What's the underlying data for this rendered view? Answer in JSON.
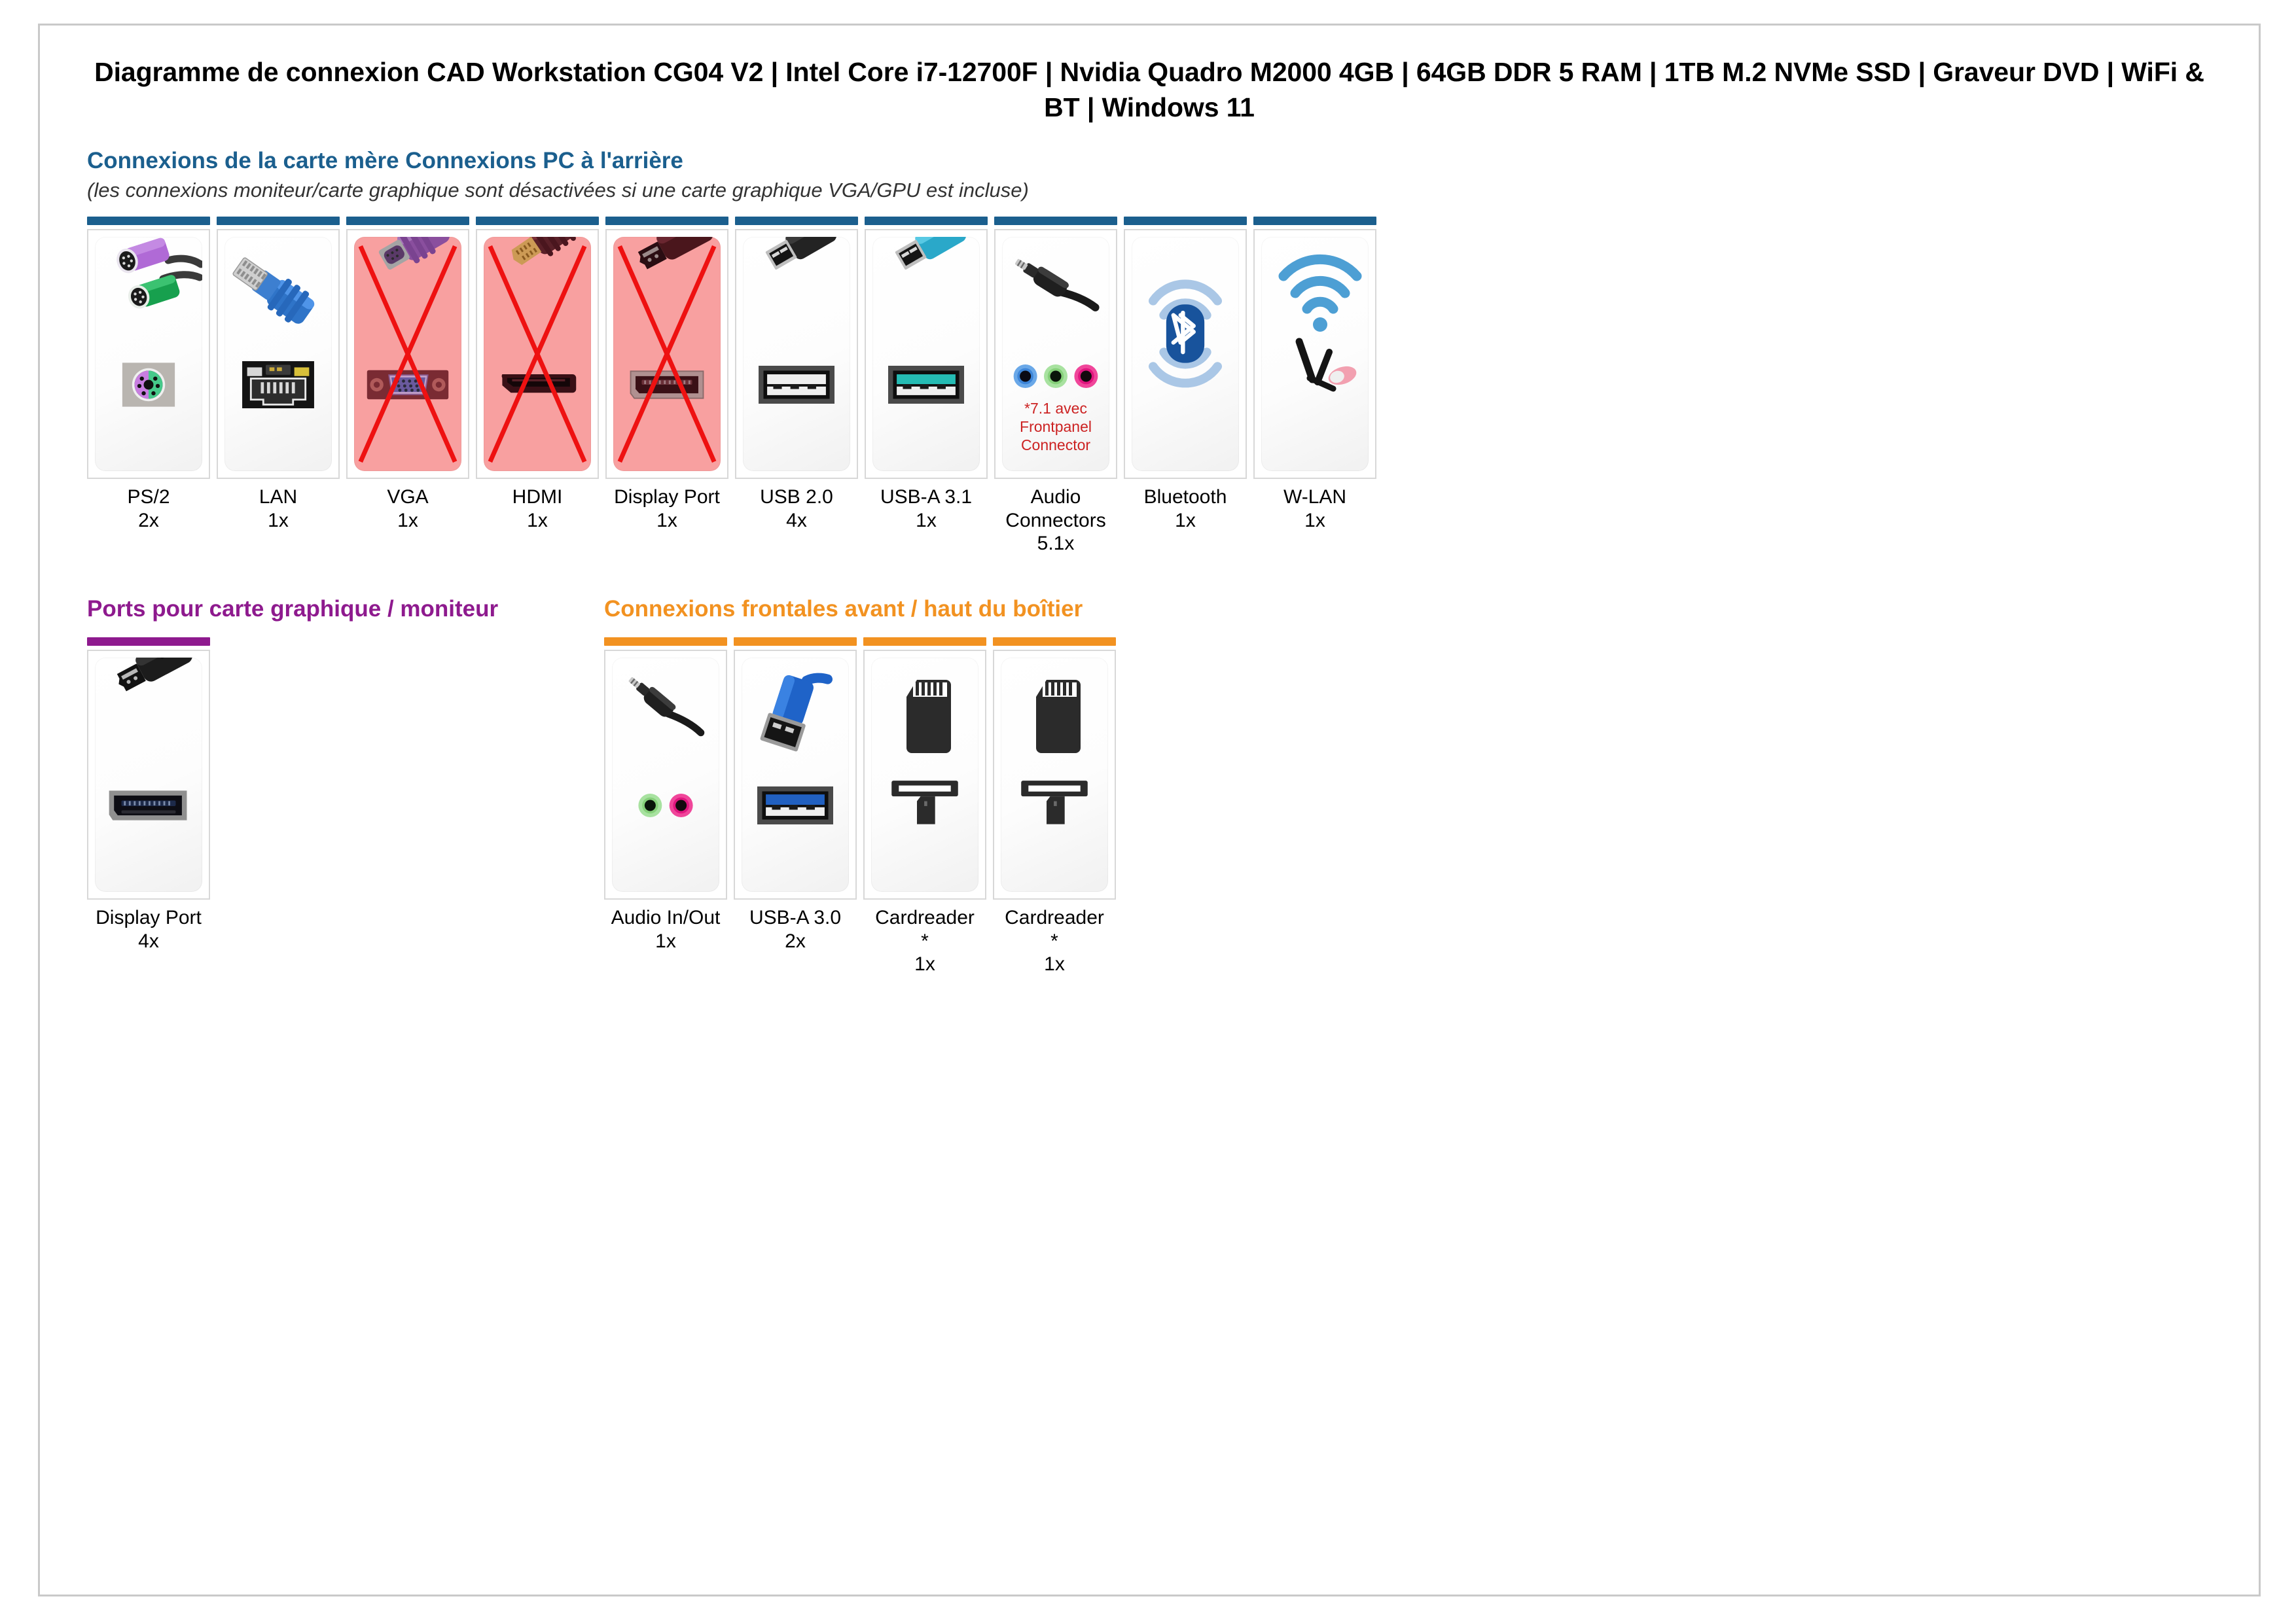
{
  "document": {
    "title": "Diagramme de connexion CAD Workstation CG04 V2 | Intel Core i7-12700F | Nvidia Quadro M2000 4GB | 64GB DDR 5 RAM | 1TB M.2 NVMe SSD | Graveur DVD | WiFi & BT | Windows 11"
  },
  "colors": {
    "blue": "#1b5f8e",
    "purple": "#8e1a8e",
    "orange": "#f29221",
    "disabled_bg": "#f8a0a0",
    "cross_red": "#ee1111",
    "note_red": "#cc2222"
  },
  "sections": [
    {
      "id": "motherboard-rear",
      "heading": "Connexions de la carte mère Connexions PC à l'arrière",
      "subheading": "(les connexions moniteur/carte graphique sont désactivées si une carte graphique VGA/GPU est incluse)",
      "accent": "blue",
      "tiles": [
        {
          "label": "PS/2",
          "count": "2x",
          "icon": "ps2-port",
          "disabled": false,
          "note": ""
        },
        {
          "label": "LAN",
          "count": "1x",
          "icon": "lan-rj45-port",
          "disabled": false,
          "note": ""
        },
        {
          "label": "VGA",
          "count": "1x",
          "icon": "vga-port",
          "disabled": true,
          "note": ""
        },
        {
          "label": "HDMI",
          "count": "1x",
          "icon": "hdmi-port",
          "disabled": true,
          "note": ""
        },
        {
          "label": "Display Port",
          "count": "1x",
          "icon": "displayport-port",
          "disabled": true,
          "note": ""
        },
        {
          "label": "USB 2.0",
          "count": "4x",
          "icon": "usb20-port",
          "disabled": false,
          "note": ""
        },
        {
          "label": "USB-A 3.1",
          "count": "1x",
          "icon": "usb31-port",
          "disabled": false,
          "note": ""
        },
        {
          "label": "Audio Connectors",
          "count": "5.1x",
          "icon": "audio-jacks-port",
          "disabled": false,
          "note": "*7.1 avec Frontpanel Connector"
        },
        {
          "label": "Bluetooth",
          "count": "1x",
          "icon": "bluetooth-icon",
          "disabled": false,
          "note": ""
        },
        {
          "label": "W-LAN",
          "count": "1x",
          "icon": "wlan-antenna-icon",
          "disabled": false,
          "note": ""
        }
      ]
    },
    {
      "id": "graphics-monitor",
      "heading": "Ports pour carte graphique / moniteur",
      "subheading": "",
      "accent": "purple",
      "tiles": [
        {
          "label": "Display Port",
          "count": "4x",
          "icon": "displayport-port",
          "disabled": false,
          "note": ""
        }
      ]
    },
    {
      "id": "front-top-case",
      "heading": "Connexions frontales avant / haut du boîtier",
      "subheading": "",
      "accent": "orange",
      "tiles": [
        {
          "label": "Audio In/Out",
          "count": "1x",
          "icon": "audio-inout-port",
          "disabled": false,
          "note": ""
        },
        {
          "label": "USB-A 3.0",
          "count": "2x",
          "icon": "usb30-port",
          "disabled": false,
          "note": ""
        },
        {
          "label": "Cardreader\n*",
          "count": "1x",
          "icon": "cardreader-icon",
          "disabled": false,
          "note": ""
        },
        {
          "label": "Cardreader\n*",
          "count": "1x",
          "icon": "cardreader-icon",
          "disabled": false,
          "note": ""
        }
      ]
    }
  ]
}
